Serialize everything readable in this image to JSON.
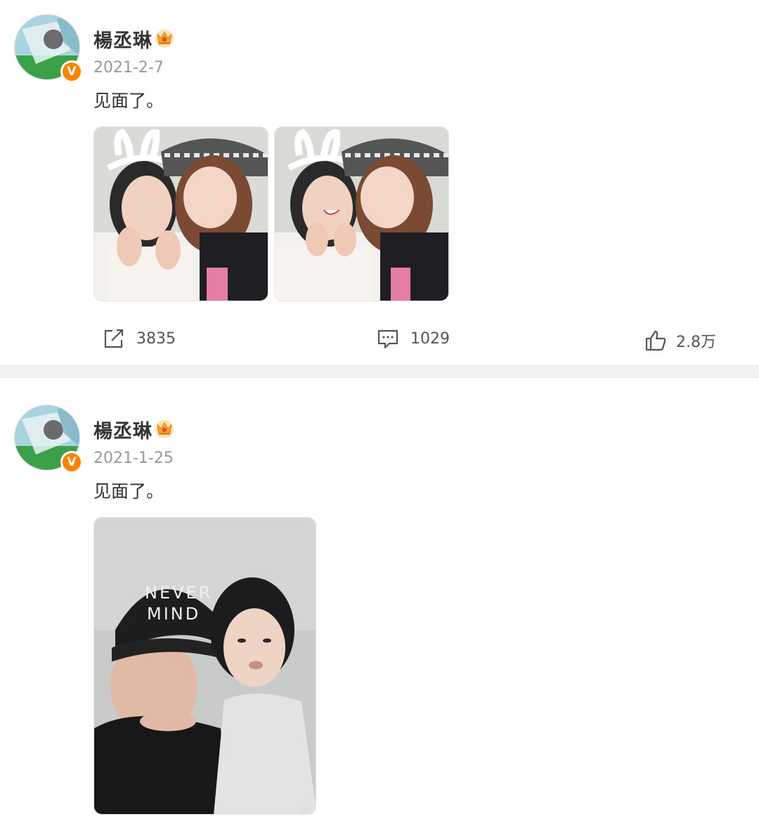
{
  "posts": [
    {
      "user_name": "楊丞琳",
      "date": "2021-2-7",
      "text": "见面了。",
      "photos": [
        "photo-bunny-ears-1",
        "photo-bunny-ears-2"
      ],
      "actions": {
        "reposts": "3835",
        "comments": "1029",
        "likes": "2.8万"
      }
    },
    {
      "user_name": "楊丞琳",
      "date": "2021-1-25",
      "text": "见面了。",
      "photos": [
        "photo-never-mind-cap"
      ],
      "cap_text_line1": "NEVER",
      "cap_text_line2": "MIND"
    }
  ],
  "colors": {
    "verified_badge": "#ff8200",
    "crown": "#f5a623",
    "divider": "#f2f2f2"
  },
  "icons": {
    "verified": "V",
    "crown": "crown-icon",
    "repost": "repost-icon",
    "comment": "comment-icon",
    "like": "thumbs-up-icon"
  }
}
